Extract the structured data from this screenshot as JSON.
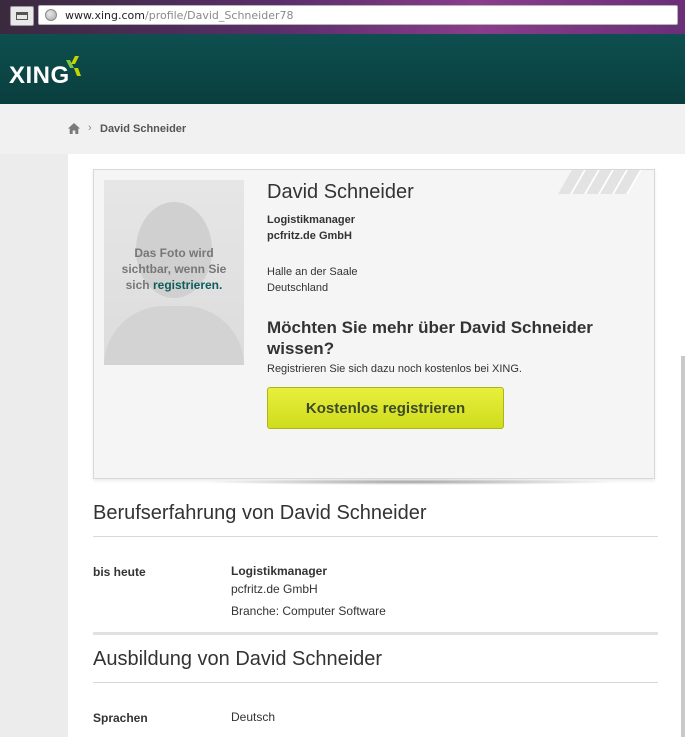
{
  "browser": {
    "url_host": "www.xing.com",
    "url_path": "/profile/David_Schneider78"
  },
  "header": {
    "logo": "XING"
  },
  "breadcrumb": {
    "current": "David Schneider"
  },
  "profile": {
    "name": "David Schneider",
    "position": "Logistikmanager",
    "company": "pcfritz.de GmbH",
    "city": "Halle an der Saale",
    "country": "Deutschland",
    "photo_hint_1": "Das Foto wird",
    "photo_hint_2": "sichtbar, wenn Sie",
    "photo_hint_3": "sich",
    "photo_link": "registrieren."
  },
  "cta": {
    "heading": "Möchten Sie mehr über David Schneider wissen?",
    "sub": "Registrieren Sie sich dazu noch kostenlos bei XING.",
    "button": "Kostenlos registrieren"
  },
  "experience": {
    "title": "Berufserfahrung von David Schneider",
    "period": "bis heute",
    "role": "Logistikmanager",
    "company": "pcfritz.de GmbH",
    "industry": "Branche: Computer Software"
  },
  "education": {
    "title": "Ausbildung von David Schneider",
    "languages_label": "Sprachen",
    "languages_value": "Deutsch"
  },
  "colors": {
    "header": "#0e4f4f",
    "button": "#d8e22a",
    "link": "#0e5d5d"
  }
}
